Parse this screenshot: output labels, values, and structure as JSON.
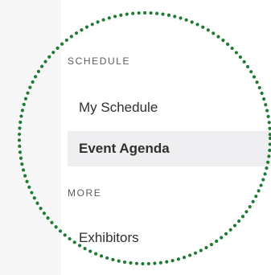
{
  "sidebar": {
    "sections": [
      {
        "header": "SCHEDULE",
        "items": [
          {
            "label": "My Schedule",
            "active": false
          },
          {
            "label": "Event Agenda",
            "active": true
          }
        ]
      },
      {
        "header": "MORE",
        "items": [
          {
            "label": "Exhibitors",
            "active": false
          }
        ]
      }
    ]
  },
  "colors": {
    "magnifier_ring": "#1f7a33",
    "active_background": "#efeff2",
    "section_header_text": "#5c5c5c",
    "item_text": "#2f2f2f"
  }
}
